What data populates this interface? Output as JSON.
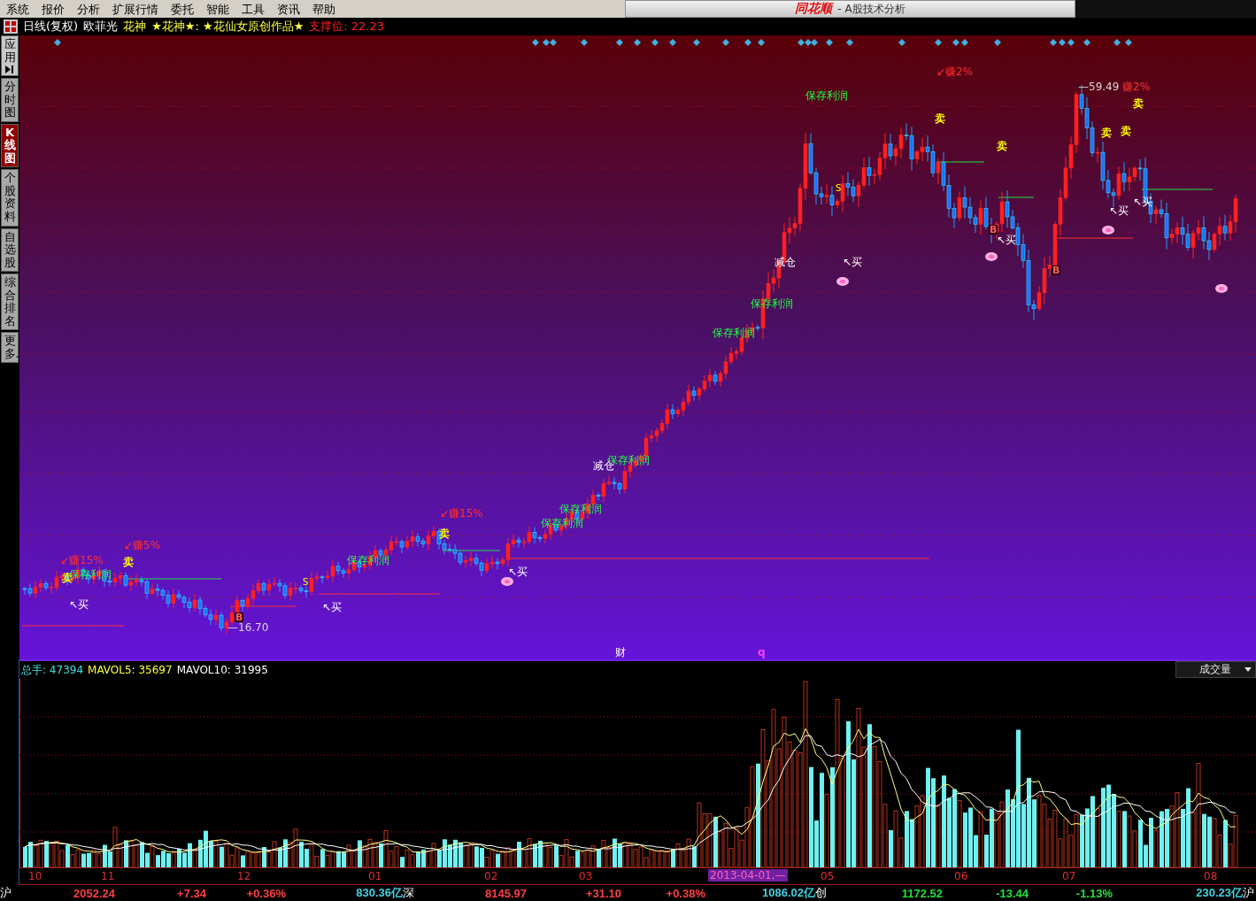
{
  "menu": [
    "系统",
    "报价",
    "分析",
    "扩展行情",
    "委托",
    "智能",
    "工具",
    "资讯",
    "帮助"
  ],
  "title": {
    "logo": "同花顺",
    "text": "- A股技术分析"
  },
  "chart_header": {
    "period": "日线(复权)",
    "stock": "欧菲光",
    "indicator": "花神",
    "formula": "★花神★: ★花仙女原创作品★",
    "support": "支撑位: 22.23"
  },
  "sidebar": {
    "items": [
      {
        "label": "应用",
        "kind": "app",
        "selected": false
      },
      {
        "label": "分时图",
        "kind": "tab",
        "selected": false
      },
      {
        "label": "K线图",
        "kind": "tab",
        "selected": true
      },
      {
        "label": "个股资料",
        "kind": "tab",
        "selected": false
      },
      {
        "label": "自选股",
        "kind": "tab",
        "selected": false
      },
      {
        "label": "综合排名",
        "kind": "tab",
        "selected": false
      },
      {
        "label": "更多..",
        "kind": "tab",
        "selected": false
      }
    ]
  },
  "annotations": [
    {
      "text": "↙赚15%",
      "kind": "gain"
    },
    {
      "text": "↙赚5%",
      "kind": "gain"
    },
    {
      "text": "卖",
      "kind": "sell"
    },
    {
      "text": "卖",
      "kind": "sell"
    },
    {
      "text": "保存利润",
      "kind": "profit"
    },
    {
      "text": "↖买",
      "kind": "buy"
    },
    {
      "text": "—16.70",
      "kind": "price"
    },
    {
      "text": "B",
      "kind": "bmark"
    },
    {
      "text": "S",
      "kind": "smark"
    },
    {
      "text": "保存利润",
      "kind": "profit"
    },
    {
      "text": "↖买",
      "kind": "buy"
    },
    {
      "text": "↙赚15%",
      "kind": "gain"
    },
    {
      "text": "卖",
      "kind": "sell"
    },
    {
      "text": "↖买",
      "kind": "buy"
    },
    {
      "text": "保存利润",
      "kind": "profit"
    },
    {
      "text": "保存利润",
      "kind": "profit"
    },
    {
      "text": "减仓",
      "kind": "reduce"
    },
    {
      "text": "保存利润",
      "kind": "profit"
    },
    {
      "text": "保存利润",
      "kind": "profit"
    },
    {
      "text": "保存利润",
      "kind": "profit"
    },
    {
      "text": "保存利润",
      "kind": "profit"
    },
    {
      "text": "减仓",
      "kind": "reduce"
    },
    {
      "text": "S",
      "kind": "smark"
    },
    {
      "text": "↖买",
      "kind": "buy"
    },
    {
      "text": "↙赚2%",
      "kind": "gain"
    },
    {
      "text": "卖",
      "kind": "sell"
    },
    {
      "text": "卖",
      "kind": "sell"
    },
    {
      "text": "B",
      "kind": "bmark"
    },
    {
      "text": "↖买",
      "kind": "buy"
    },
    {
      "text": "B",
      "kind": "bmark"
    },
    {
      "text": "—59.49",
      "kind": "price"
    },
    {
      "text": "赚2%",
      "kind": "gain"
    },
    {
      "text": "卖",
      "kind": "sell"
    },
    {
      "text": "卖",
      "kind": "sell"
    },
    {
      "text": "卖",
      "kind": "sell"
    },
    {
      "text": "↖买",
      "kind": "buy"
    },
    {
      "text": "↖买",
      "kind": "buy"
    },
    {
      "text": "财",
      "kind": "event"
    },
    {
      "text": "q",
      "kind": "event-q"
    }
  ],
  "volume": {
    "total_label": "总手:",
    "total": "47394",
    "ma5_label": "MAVOL5:",
    "ma5": "35697",
    "ma10_label": "MAVOL10:",
    "ma10": "31995",
    "selector": "成交量"
  },
  "time_axis": [
    {
      "label": "10",
      "kind": "month"
    },
    {
      "label": "11",
      "kind": "month"
    },
    {
      "label": "12",
      "kind": "month"
    },
    {
      "label": "01",
      "kind": "month"
    },
    {
      "label": "02",
      "kind": "month"
    },
    {
      "label": "03",
      "kind": "month"
    },
    {
      "label": "2013-04-01,—",
      "kind": "cursor"
    },
    {
      "label": "05",
      "kind": "month"
    },
    {
      "label": "06",
      "kind": "month"
    },
    {
      "label": "07",
      "kind": "month"
    },
    {
      "label": "08",
      "kind": "month"
    }
  ],
  "status_bar": [
    {
      "text": "沪",
      "kind": "name"
    },
    {
      "text": "2052.24",
      "kind": "up"
    },
    {
      "text": "+7.34",
      "kind": "up"
    },
    {
      "text": "+0.36%",
      "kind": "up"
    },
    {
      "text": "830.36亿",
      "kind": "amount"
    },
    {
      "text": "深",
      "kind": "name"
    },
    {
      "text": "8145.97",
      "kind": "up"
    },
    {
      "text": "+31.10",
      "kind": "up"
    },
    {
      "text": "+0.38%",
      "kind": "up"
    },
    {
      "text": "1086.02亿",
      "kind": "amount"
    },
    {
      "text": "创",
      "kind": "name"
    },
    {
      "text": "1172.52",
      "kind": "down"
    },
    {
      "text": "-13.44",
      "kind": "down"
    },
    {
      "text": "-1.13%",
      "kind": "down"
    },
    {
      "text": "230.23亿",
      "kind": "amount"
    },
    {
      "text": "沪",
      "kind": "name"
    }
  ]
}
